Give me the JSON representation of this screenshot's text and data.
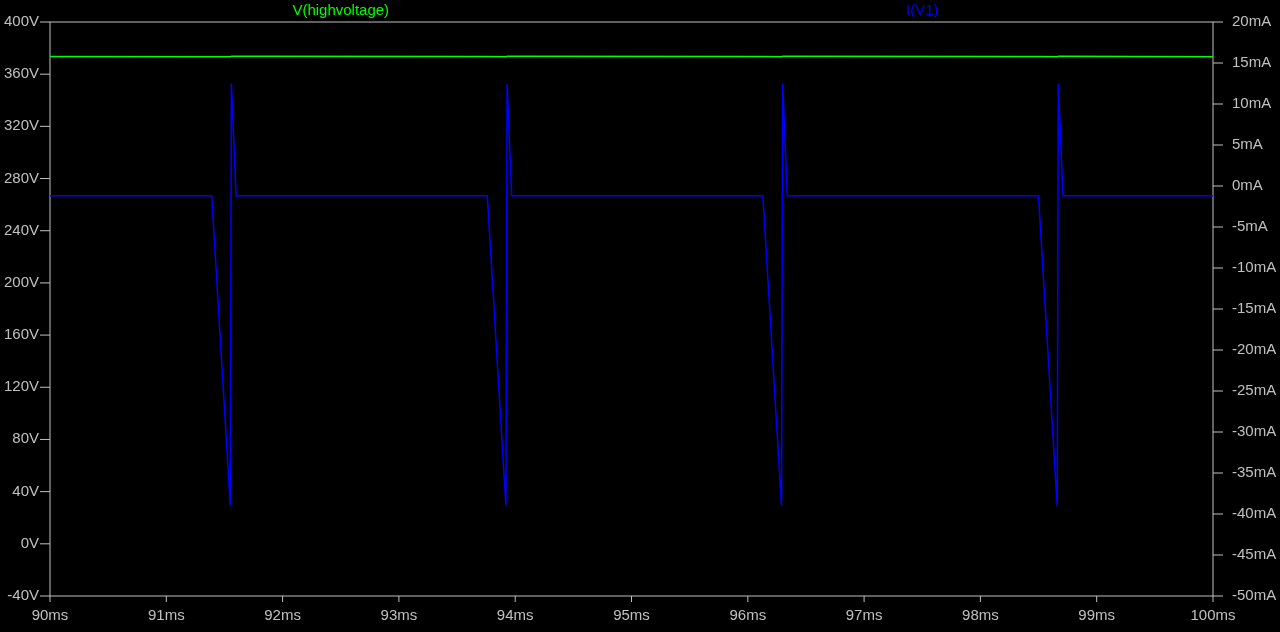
{
  "plot": {
    "chart_data": {
      "type": "line",
      "x": [
        90,
        91.39,
        91.55,
        91.56,
        91.6,
        93.76,
        93.92,
        93.93,
        93.97,
        96.13,
        96.29,
        96.3,
        96.34,
        98.5,
        98.66,
        98.67,
        98.71,
        100
      ],
      "series": [
        {
          "name": "V(highvoltage)",
          "color": "#00ff00",
          "axis": "y",
          "values": [
            373.5,
            373.3,
            373.3,
            373.8,
            373.8,
            373.6,
            373.3,
            373.8,
            373.8,
            373.6,
            373.3,
            373.8,
            373.8,
            373.6,
            373.3,
            373.8,
            373.8,
            373.3
          ]
        },
        {
          "name": "I(V1)",
          "color": "#0000ff",
          "axis": "y2",
          "values": [
            -1.2,
            -1.2,
            -39,
            12.5,
            -1.2,
            -1.2,
            -39,
            12.5,
            -1.2,
            -1.2,
            -39,
            12.5,
            -1.2,
            -1.2,
            -39,
            12.5,
            -1.2,
            -1.2
          ]
        }
      ],
      "xlim": [
        90,
        100
      ],
      "xticks": [
        {
          "value": 90,
          "label": "90ms"
        },
        {
          "value": 91,
          "label": "91ms"
        },
        {
          "value": 92,
          "label": "92ms"
        },
        {
          "value": 93,
          "label": "93ms"
        },
        {
          "value": 94,
          "label": "94ms"
        },
        {
          "value": 95,
          "label": "95ms"
        },
        {
          "value": 96,
          "label": "96ms"
        },
        {
          "value": 97,
          "label": "97ms"
        },
        {
          "value": 98,
          "label": "98ms"
        },
        {
          "value": 99,
          "label": "99ms"
        },
        {
          "value": 100,
          "label": "100ms"
        }
      ],
      "ylim": [
        -40,
        400
      ],
      "yticks": [
        {
          "value": 400,
          "label": "400V"
        },
        {
          "value": 360,
          "label": "360V"
        },
        {
          "value": 320,
          "label": "320V"
        },
        {
          "value": 280,
          "label": "280V"
        },
        {
          "value": 240,
          "label": "240V"
        },
        {
          "value": 200,
          "label": "200V"
        },
        {
          "value": 160,
          "label": "160V"
        },
        {
          "value": 120,
          "label": "120V"
        },
        {
          "value": 80,
          "label": "80V"
        },
        {
          "value": 40,
          "label": "40V"
        },
        {
          "value": 0,
          "label": "0V"
        },
        {
          "value": -40,
          "label": "-40V"
        }
      ],
      "y2lim": [
        -50,
        20
      ],
      "y2ticks": [
        {
          "value": 20,
          "label": "20mA"
        },
        {
          "value": 15,
          "label": "15mA"
        },
        {
          "value": 10,
          "label": "10mA"
        },
        {
          "value": 5,
          "label": "5mA"
        },
        {
          "value": 0,
          "label": "0mA"
        },
        {
          "value": -5,
          "label": "-5mA"
        },
        {
          "value": -10,
          "label": "-10mA"
        },
        {
          "value": -15,
          "label": "-15mA"
        },
        {
          "value": -20,
          "label": "-20mA"
        },
        {
          "value": -25,
          "label": "-25mA"
        },
        {
          "value": -30,
          "label": "-30mA"
        },
        {
          "value": -35,
          "label": "-35mA"
        },
        {
          "value": -40,
          "label": "-40mA"
        },
        {
          "value": -45,
          "label": "-45mA"
        },
        {
          "value": -50,
          "label": "-50mA"
        }
      ]
    }
  }
}
